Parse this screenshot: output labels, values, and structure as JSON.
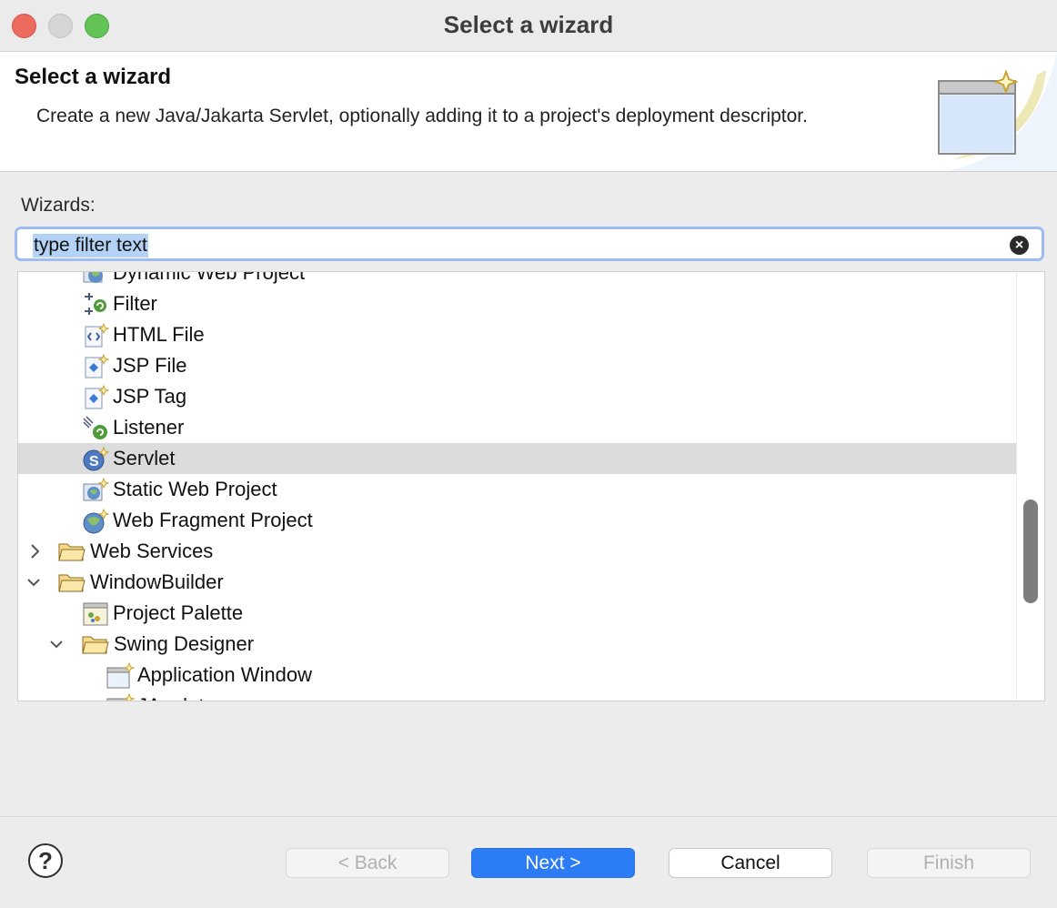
{
  "window": {
    "title": "Select a wizard"
  },
  "header": {
    "title": "Select a wizard",
    "description": "Create a new Java/Jakarta Servlet, optionally adding it to a project's deployment descriptor."
  },
  "wizards_label": "Wizards:",
  "filter": {
    "value": "type filter text"
  },
  "tree": {
    "items": [
      {
        "label": "Dynamic Web Project",
        "icon": "web-project-icon"
      },
      {
        "label": "Filter",
        "icon": "filter-icon"
      },
      {
        "label": "HTML File",
        "icon": "html-file-icon"
      },
      {
        "label": "JSP File",
        "icon": "jsp-file-icon"
      },
      {
        "label": "JSP Tag",
        "icon": "jsp-tag-icon"
      },
      {
        "label": "Listener",
        "icon": "listener-icon"
      },
      {
        "label": "Servlet",
        "icon": "servlet-icon",
        "selected": true
      },
      {
        "label": "Static Web Project",
        "icon": "static-web-project-icon"
      },
      {
        "label": "Web Fragment Project",
        "icon": "web-fragment-project-icon"
      },
      {
        "label": "Web Services",
        "icon": "folder-icon",
        "expandable": true,
        "expanded": false
      },
      {
        "label": "WindowBuilder",
        "icon": "folder-icon",
        "expandable": true,
        "expanded": true
      },
      {
        "label": "Project Palette",
        "icon": "palette-icon"
      },
      {
        "label": "Swing Designer",
        "icon": "folder-icon",
        "expandable": true,
        "expanded": true
      },
      {
        "label": "Application Window",
        "icon": "application-window-icon"
      },
      {
        "label": "JApplet",
        "icon": "japplet-icon"
      }
    ]
  },
  "buttons": {
    "help": "?",
    "back": "< Back",
    "next": "Next >",
    "cancel": "Cancel",
    "finish": "Finish"
  },
  "colors": {
    "accent": "#2c7cf6",
    "selection": "#dcdcdc",
    "filter_focus": "#9cbcf3"
  }
}
